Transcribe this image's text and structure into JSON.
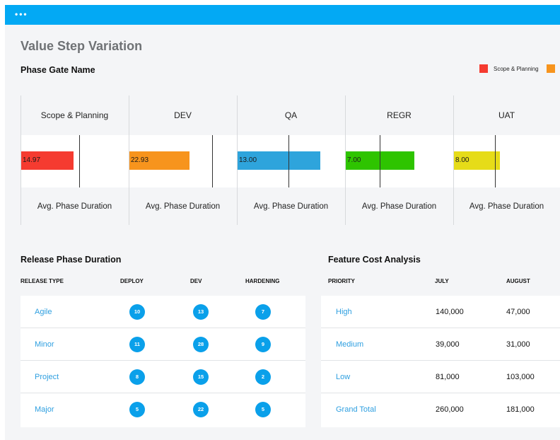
{
  "window": {
    "dots": "•••"
  },
  "page_title": "Value Step Variation",
  "phase_section": {
    "title": "Phase Gate Name",
    "legend": [
      {
        "label": "Scope & Planning",
        "color": "#f53b30"
      },
      {
        "label": "",
        "color": "#f7941d"
      }
    ],
    "phases": [
      {
        "name": "Scope & Planning",
        "value": "14.97",
        "color": "#f53b30",
        "fill": 0.49,
        "target": 0.54,
        "footer": "Avg. Phase Duration"
      },
      {
        "name": "DEV",
        "value": "22.93",
        "color": "#f7941d",
        "fill": 0.56,
        "target": 0.77,
        "footer": "Avg. Phase Duration"
      },
      {
        "name": "QA",
        "value": "13.00",
        "color": "#2ea4dc",
        "fill": 0.77,
        "target": 0.48,
        "footer": "Avg. Phase Duration"
      },
      {
        "name": "REGR",
        "value": "7.00",
        "color": "#2ec400",
        "fill": 0.64,
        "target": 0.32,
        "footer": "Avg. Phase Duration"
      },
      {
        "name": "UAT",
        "value": "8.00",
        "color": "#e6dc18",
        "fill": 0.44,
        "target": 0.39,
        "footer": "Avg. Phase Duration"
      }
    ]
  },
  "release_section": {
    "title": "Release Phase Duration",
    "columns": [
      "RELEASE TYPE",
      "DEPLOY",
      "DEV",
      "HARDENING"
    ],
    "rows": [
      {
        "type": "Agile",
        "deploy": "10",
        "dev": "13",
        "hardening": "7"
      },
      {
        "type": "Minor",
        "deploy": "11",
        "dev": "28",
        "hardening": "9"
      },
      {
        "type": "Project",
        "deploy": "8",
        "dev": "15",
        "hardening": "2"
      },
      {
        "type": "Major",
        "deploy": "5",
        "dev": "22",
        "hardening": "5"
      }
    ]
  },
  "cost_section": {
    "title": "Feature Cost Analysis",
    "columns": [
      "PRIORITY",
      "JULY",
      "AUGUST"
    ],
    "rows": [
      {
        "priority": "High",
        "july": "140,000",
        "august": "47,000"
      },
      {
        "priority": "Medium",
        "july": "39,000",
        "august": "31,000"
      },
      {
        "priority": "Low",
        "july": "81,000",
        "august": "103,000"
      },
      {
        "priority": "Grand Total",
        "july": "260,000",
        "august": "181,000"
      }
    ]
  },
  "colors": {
    "accent": "#03a9f4",
    "link": "#2e9fe0",
    "badge": "#0aa0ea"
  }
}
